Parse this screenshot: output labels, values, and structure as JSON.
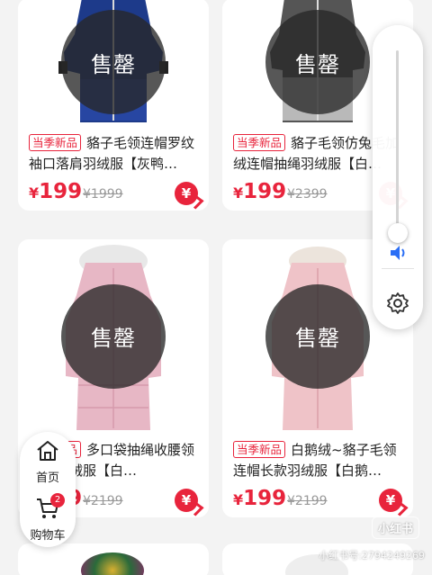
{
  "sold_label": "售罄",
  "currency": "¥",
  "products": [
    {
      "tag": "当季新品",
      "title": "貉子毛领连帽罗纹袖口落肩羽绒服【灰鸭…",
      "price": "199",
      "original_price": "¥1999",
      "coat_color": "#1e3b8c",
      "sold_out": true
    },
    {
      "tag": "当季新品",
      "title": "貉子毛领仿兔毛加绒连帽抽绳羽绒服【白…",
      "price": "199",
      "original_price": "¥2399",
      "coat_color": "#8e8e8e",
      "sold_out": true
    },
    {
      "tag": "当季新品",
      "title": "多口袋抽绳收腰领连帽羽绒服【白…",
      "price": "199",
      "original_price": "¥2199",
      "coat_color": "#e9b8c6",
      "sold_out": true
    },
    {
      "tag": "当季新品",
      "title": "白鹅绒~貉子毛领连帽长款羽绒服【白鹅…",
      "price": "199",
      "original_price": "¥2199",
      "coat_color": "#f0c4c8",
      "sold_out": true
    }
  ],
  "nav": {
    "home": "首页",
    "cart": "购物车",
    "cart_count": "2"
  },
  "volume": {
    "level": 0.03
  },
  "watermark": {
    "logo": "小红书",
    "id": "小红书号:2794249269"
  },
  "colors": {
    "accent": "#e8243c",
    "volume": "#2a6ef5"
  }
}
